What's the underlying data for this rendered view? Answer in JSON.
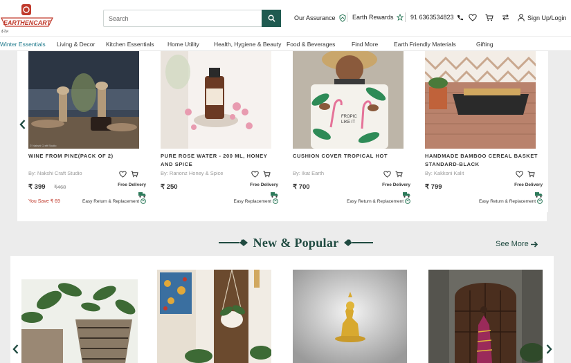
{
  "header": {
    "logo_text": "EARTHENCART",
    "search_placeholder": "Search",
    "assurance": "Our Assurance",
    "rewards": "Earth Rewards",
    "phone": "91 6363534823",
    "signup": "Sign Up/Login"
  },
  "nav": [
    "Winter Essentials",
    "Living & Decor",
    "Kitchen Essentials",
    "Home Utility",
    "Health, Hygiene & Beauty",
    "Food & Beverages",
    "Find More",
    "Earth Friendly Materials",
    "Gifting"
  ],
  "products": [
    {
      "title": "WINE FROM PINE(PACK OF 2)",
      "vendor": "By: Nakshi Craft Studio",
      "price": "₹ 399",
      "mrp": "₹468",
      "save": "You Save ₹ 69",
      "free": "Free Delivery",
      "return": "Easy Return & Replacement"
    },
    {
      "title": "PURE ROSE WATER - 200 ML, HONEY AND SPICE",
      "vendor": "By: Ranonz Honey & Spice",
      "price": "₹ 250",
      "mrp": "",
      "save": "",
      "free": "Free Delivery",
      "return": "Easy Replacement"
    },
    {
      "title": "CUSHION COVER TROPICAL HOT",
      "vendor": "By: Ikat Earth",
      "price": "₹ 700",
      "mrp": "",
      "save": "",
      "free": "Free Delivery",
      "return": "Easy Return & Replacement"
    },
    {
      "title": "HANDMADE BAMBOO CEREAL BASKET STANDARD-BLACK",
      "vendor": "By: Kakkoni Kalit",
      "price": "₹ 799",
      "mrp": "",
      "save": "",
      "free": "Free Delivery",
      "return": "Easy Return & Replacement"
    }
  ],
  "new_popular": {
    "title": "New & Popular",
    "see_more": "See More"
  },
  "colors": {
    "brand": "#1f5a50",
    "accent": "#1f7a8c",
    "sale": "#c0392b"
  }
}
